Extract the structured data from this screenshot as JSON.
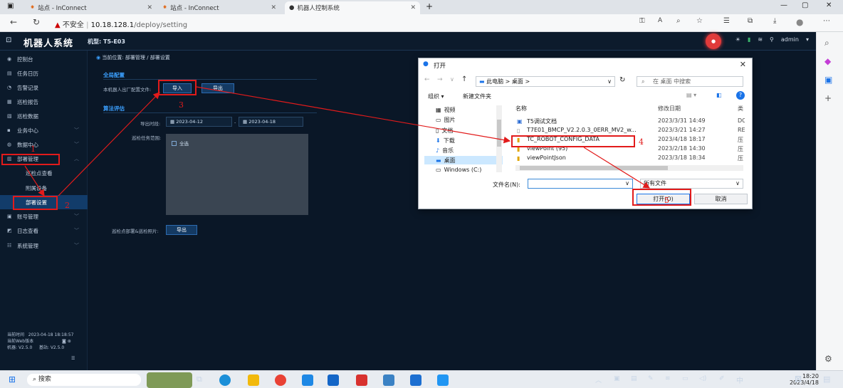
{
  "browser": {
    "tabs": [
      {
        "label": "站点 - InConnect"
      },
      {
        "label": "站点 - InConnect"
      },
      {
        "label": "机器人控制系统"
      }
    ],
    "security_label": "不安全",
    "url_host": "10.18.128.1",
    "url_path": "/deploy/setting"
  },
  "app": {
    "title": "机器人系统",
    "model": "机型: T5-E03",
    "user": "admin",
    "breadcrumb": "当前位置: 部署管理 / 部署设置"
  },
  "nav": {
    "items": [
      {
        "label": "控制台"
      },
      {
        "label": "任务日历"
      },
      {
        "label": "告警记录"
      },
      {
        "label": "巡检报告"
      },
      {
        "label": "巡检数据"
      },
      {
        "label": "业务中心"
      },
      {
        "label": "数据中心"
      },
      {
        "label": "部署管理"
      },
      {
        "label": "巡检点查看"
      },
      {
        "label": "附属设备"
      },
      {
        "label": "部署设置"
      },
      {
        "label": "账号管理"
      },
      {
        "label": "日志查看"
      },
      {
        "label": "系统管理"
      }
    ],
    "footer": {
      "time_label": "当前时间",
      "time_value": "2023-04-18 18:18:57",
      "web_label": "当前Web版本",
      "fw_label": "机器:",
      "fw_value": "V2.5.0",
      "base_label": "基站:",
      "base_value": "V2.5.0"
    }
  },
  "settings": {
    "global_title": "全局配置",
    "import_label": "本机器人出厂配置文件:",
    "import_button": "导入",
    "export_button": "导出",
    "eval_title": "算法评估",
    "date_label": "导出时段:",
    "date_from": "2023-04-12",
    "date_to": "2023-04-18",
    "date_sep": "-",
    "scope_label": "巡检任务范围:",
    "scope_all": "全选",
    "deploy_label": "巡检点部署&巡检照片:",
    "deploy_export": "导出"
  },
  "dialog": {
    "title": "打开",
    "path": "此电脑 > 桌面 >",
    "search_placeholder": "在 桌面 中搜索",
    "organize": "组织 ▾",
    "new_folder": "新建文件夹",
    "tree": [
      {
        "label": "视频"
      },
      {
        "label": "图片"
      },
      {
        "label": "文档"
      },
      {
        "label": "下载"
      },
      {
        "label": "音乐"
      },
      {
        "label": "桌面"
      },
      {
        "label": "Windows (C:)"
      }
    ],
    "col_name": "名称",
    "col_date": "修改日期",
    "col_type": "类",
    "files": [
      {
        "name": "T5调试文档",
        "date": "2023/3/31 14:49",
        "type": "DC"
      },
      {
        "name": "T7E01_BMCP_V2.2.0.3_0ERR_MV2_w...",
        "date": "2023/3/21 14:27",
        "type": "RE"
      },
      {
        "name": "TC_ROBOT_CONFIG_DATA",
        "date": "2023/4/18 18:17",
        "type": "压"
      },
      {
        "name": "viewPoint (95)",
        "date": "2023/2/18 14:30",
        "type": "压"
      },
      {
        "name": "viewPointJson",
        "date": "2023/3/18 18:34",
        "type": "压"
      }
    ],
    "filename_label": "文件名(N):",
    "filetype": "所有文件",
    "open_button": "打开(O)",
    "cancel_button": "取消"
  },
  "annotations": [
    "1",
    "2",
    "3",
    "4",
    "5"
  ],
  "taskbar": {
    "search": "搜索",
    "ime": "中",
    "time": "18:20",
    "date": "2023/4/18"
  },
  "colors": {
    "annotation": "#e21b1b",
    "accent": "#2c6bb0",
    "selected_nav": "#123c6a"
  }
}
